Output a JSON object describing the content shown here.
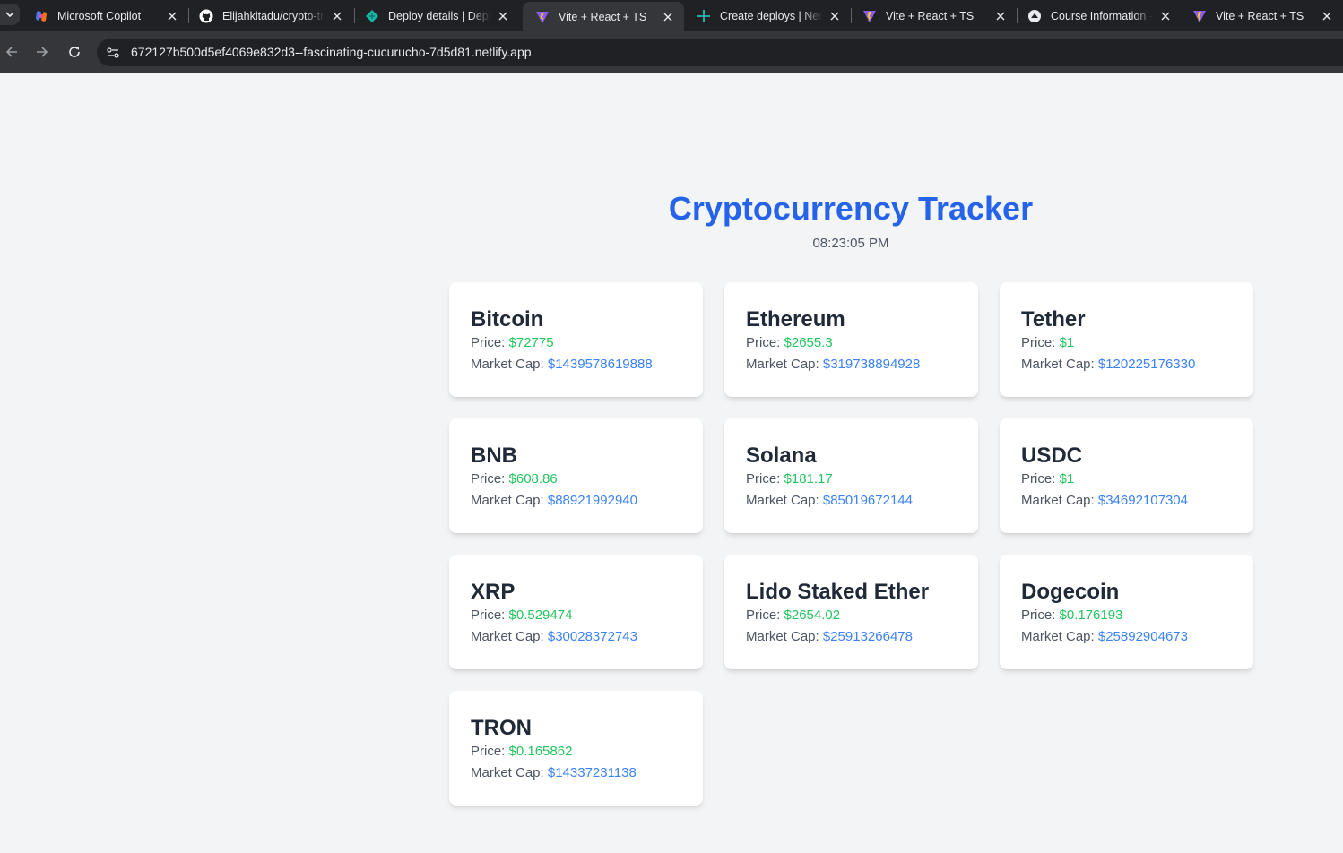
{
  "browser": {
    "tabs": [
      {
        "title": "Microsoft Copilot",
        "icon": "copilot-icon"
      },
      {
        "title": "Elijahkitadu/crypto-tr",
        "icon": "github-icon"
      },
      {
        "title": "Deploy details | Deplo",
        "icon": "netlify-icon"
      },
      {
        "title": "Vite + React + TS",
        "icon": "vite-icon",
        "active": true
      },
      {
        "title": "Create deploys | Netli",
        "icon": "netlify-create-icon"
      },
      {
        "title": "Vite + React + TS",
        "icon": "vite-icon"
      },
      {
        "title": "Course Information -",
        "icon": "course-icon"
      },
      {
        "title": "Vite + React + TS",
        "icon": "vite-icon"
      }
    ],
    "url": "672127b500d5ef4069e832d3--fascinating-cucurucho-7d5d81.netlify.app"
  },
  "page": {
    "title": "Cryptocurrency Tracker",
    "time": "08:23:05 PM",
    "price_label": "Price:",
    "cap_label": "Market Cap:",
    "coins": [
      {
        "name": "Bitcoin",
        "price": "$72775",
        "cap": "$1439578619888"
      },
      {
        "name": "Ethereum",
        "price": "$2655.3",
        "cap": "$319738894928"
      },
      {
        "name": "Tether",
        "price": "$1",
        "cap": "$120225176330"
      },
      {
        "name": "BNB",
        "price": "$608.86",
        "cap": "$88921992940"
      },
      {
        "name": "Solana",
        "price": "$181.17",
        "cap": "$85019672144"
      },
      {
        "name": "USDC",
        "price": "$1",
        "cap": "$34692107304"
      },
      {
        "name": "XRP",
        "price": "$0.529474",
        "cap": "$30028372743"
      },
      {
        "name": "Lido Staked Ether",
        "price": "$2654.02",
        "cap": "$25913266478"
      },
      {
        "name": "Dogecoin",
        "price": "$0.176193",
        "cap": "$25892904673"
      },
      {
        "name": "TRON",
        "price": "$0.165862",
        "cap": "$14337231138"
      }
    ]
  },
  "colors": {
    "heading": "#2563eb",
    "price": "#22c55e",
    "market_cap": "#3b82f6",
    "background": "#f3f4f6"
  }
}
